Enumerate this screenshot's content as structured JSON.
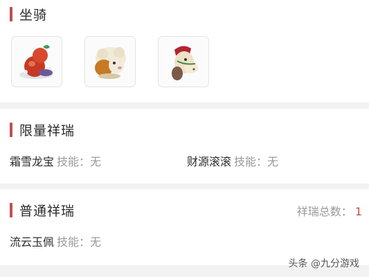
{
  "mounts_section": {
    "title": "坐骑",
    "items": [
      {
        "icon": "dragon-gourd-mount-icon"
      },
      {
        "icon": "sheep-mount-icon"
      },
      {
        "icon": "horse-mount-icon"
      }
    ]
  },
  "limited_section": {
    "title": "限量祥瑞",
    "items": [
      {
        "name": "霜雪龙宝",
        "skill": "技能：无"
      },
      {
        "name": "财源滚滚",
        "skill": "技能：无"
      }
    ]
  },
  "normal_section": {
    "title": "普通祥瑞",
    "total_label": "祥瑞总数：",
    "total_value": "1",
    "items": [
      {
        "name": "流云玉佩",
        "skill": "技能：无"
      }
    ]
  },
  "watermark": "头条 @九分游戏",
  "colors": {
    "accent": "#c0504d",
    "muted": "#999999",
    "background": "#f2f2f2"
  }
}
